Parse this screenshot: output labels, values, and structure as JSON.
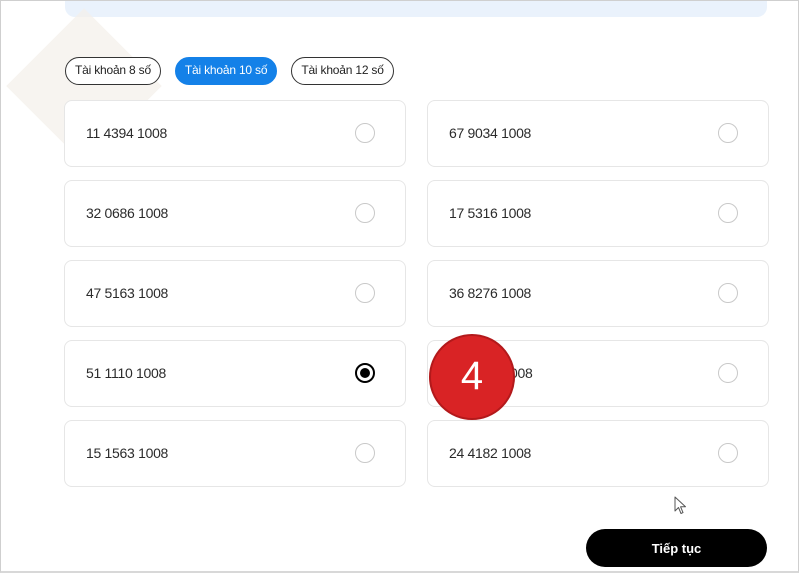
{
  "tabs": [
    {
      "label": "Tài khoản 8 số",
      "active": false
    },
    {
      "label": "Tài khoản 10 số",
      "active": true
    },
    {
      "label": "Tài khoản 12 số",
      "active": false
    }
  ],
  "accounts": [
    {
      "number": "11 4394 1008",
      "selected": false
    },
    {
      "number": "67 9034 1008",
      "selected": false
    },
    {
      "number": "32 0686 1008",
      "selected": false
    },
    {
      "number": "17 5316 1008",
      "selected": false
    },
    {
      "number": "47 5163 1008",
      "selected": false
    },
    {
      "number": "36 8276 1008",
      "selected": false
    },
    {
      "number": "51 1110 1008",
      "selected": true
    },
    {
      "number": "008",
      "selected": false
    },
    {
      "number": "15 1563 1008",
      "selected": false
    },
    {
      "number": "24 4182 1008",
      "selected": false
    }
  ],
  "step_marker": "4",
  "continue_label": "Tiếp tục",
  "colors": {
    "accent": "#1481e8",
    "marker": "#d92325",
    "primary_button": "#000000"
  }
}
